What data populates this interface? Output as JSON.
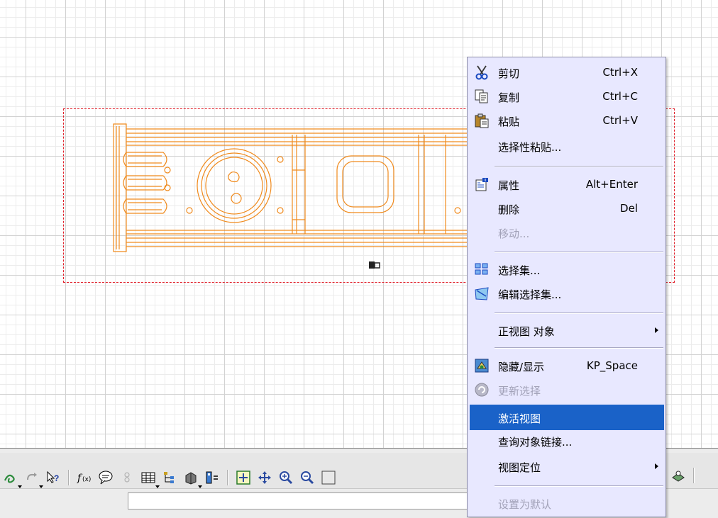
{
  "canvas": {
    "grid": true,
    "frame_color": "#e0202a",
    "drawing_color": "#f08a1c"
  },
  "context_menu": {
    "items": [
      {
        "icon": "scissors-icon",
        "label": "剪切",
        "shortcut": "Ctrl+X",
        "enabled": true
      },
      {
        "icon": "copy-icon",
        "label": "复制",
        "shortcut": "Ctrl+C",
        "enabled": true
      },
      {
        "icon": "paste-icon",
        "label": "粘贴",
        "shortcut": "Ctrl+V",
        "enabled": true
      },
      {
        "icon": "",
        "label": "选择性粘贴...",
        "shortcut": "",
        "enabled": true
      },
      {
        "icon": "properties-icon",
        "label": "属性",
        "shortcut": "Alt+Enter",
        "enabled": true
      },
      {
        "icon": "",
        "label": "删除",
        "shortcut": "Del",
        "enabled": true
      },
      {
        "icon": "",
        "label": "移动...",
        "shortcut": "",
        "enabled": false
      },
      {
        "icon": "selection-sets-icon",
        "label": "选择集...",
        "shortcut": "",
        "enabled": true
      },
      {
        "icon": "edit-selection-sets-icon",
        "label": "编辑选择集...",
        "shortcut": "",
        "enabled": true
      },
      {
        "icon": "",
        "label": "正视图 对象",
        "shortcut": "",
        "enabled": true,
        "submenu": true
      },
      {
        "icon": "hide-show-icon",
        "label": "隐藏/显示",
        "shortcut": "KP_Space",
        "enabled": true
      },
      {
        "icon": "update-selection-icon",
        "label": "更新选择",
        "shortcut": "",
        "enabled": false
      },
      {
        "icon": "",
        "label": "激活视图",
        "shortcut": "",
        "enabled": true,
        "highlighted": true
      },
      {
        "icon": "",
        "label": "查询对象链接...",
        "shortcut": "",
        "enabled": true
      },
      {
        "icon": "",
        "label": "视图定位",
        "shortcut": "",
        "enabled": true,
        "submenu": true
      },
      {
        "icon": "",
        "label": "设置为默认",
        "shortcut": "",
        "enabled": false
      }
    ],
    "highlight_color": "#1a62c8",
    "background_color": "#e8e8ff"
  },
  "toolbar": {
    "buttons": [
      "spring-icon",
      "redo-icon",
      "whats-this-icon",
      "formula-icon",
      "comment-icon",
      "knowledge-icon",
      "table-icon",
      "tree-icon",
      "catalog-icon",
      "parameter-icon",
      "fit-all-icon",
      "pan-icon",
      "zoom-in-icon",
      "zoom-out-icon",
      "normal-view-icon",
      "render-icon"
    ]
  }
}
